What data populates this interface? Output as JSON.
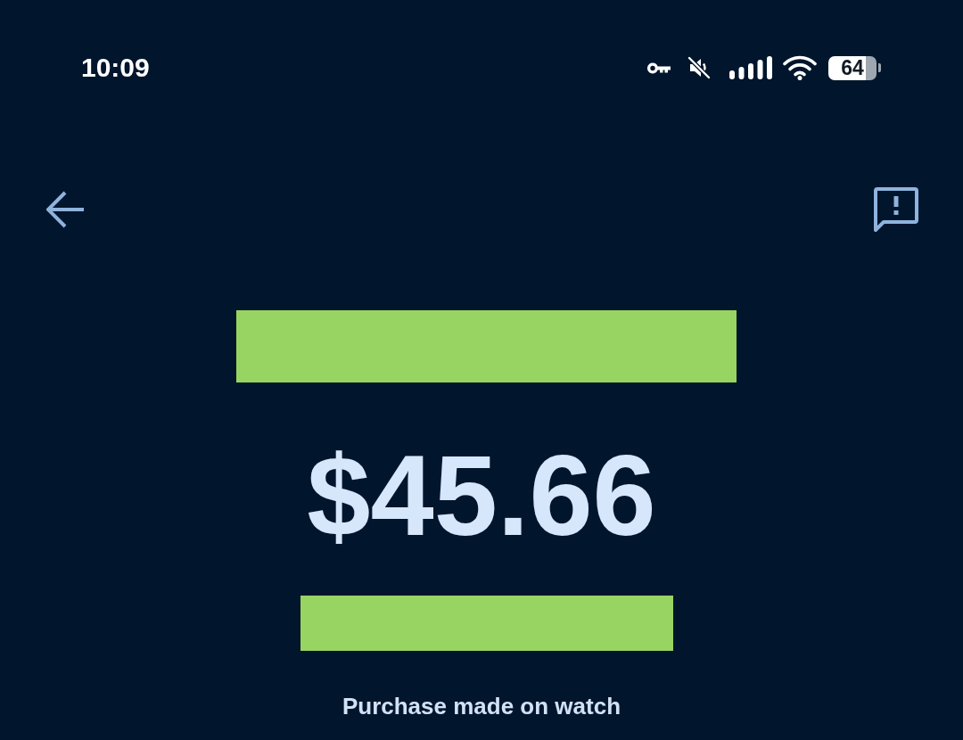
{
  "status_bar": {
    "time": "10:09",
    "battery": "64"
  },
  "transaction": {
    "merchant": {
      "kind": "redacted"
    },
    "amount": "$45.66",
    "detail": {
      "kind": "redacted"
    },
    "note": "Purchase made on watch"
  }
}
